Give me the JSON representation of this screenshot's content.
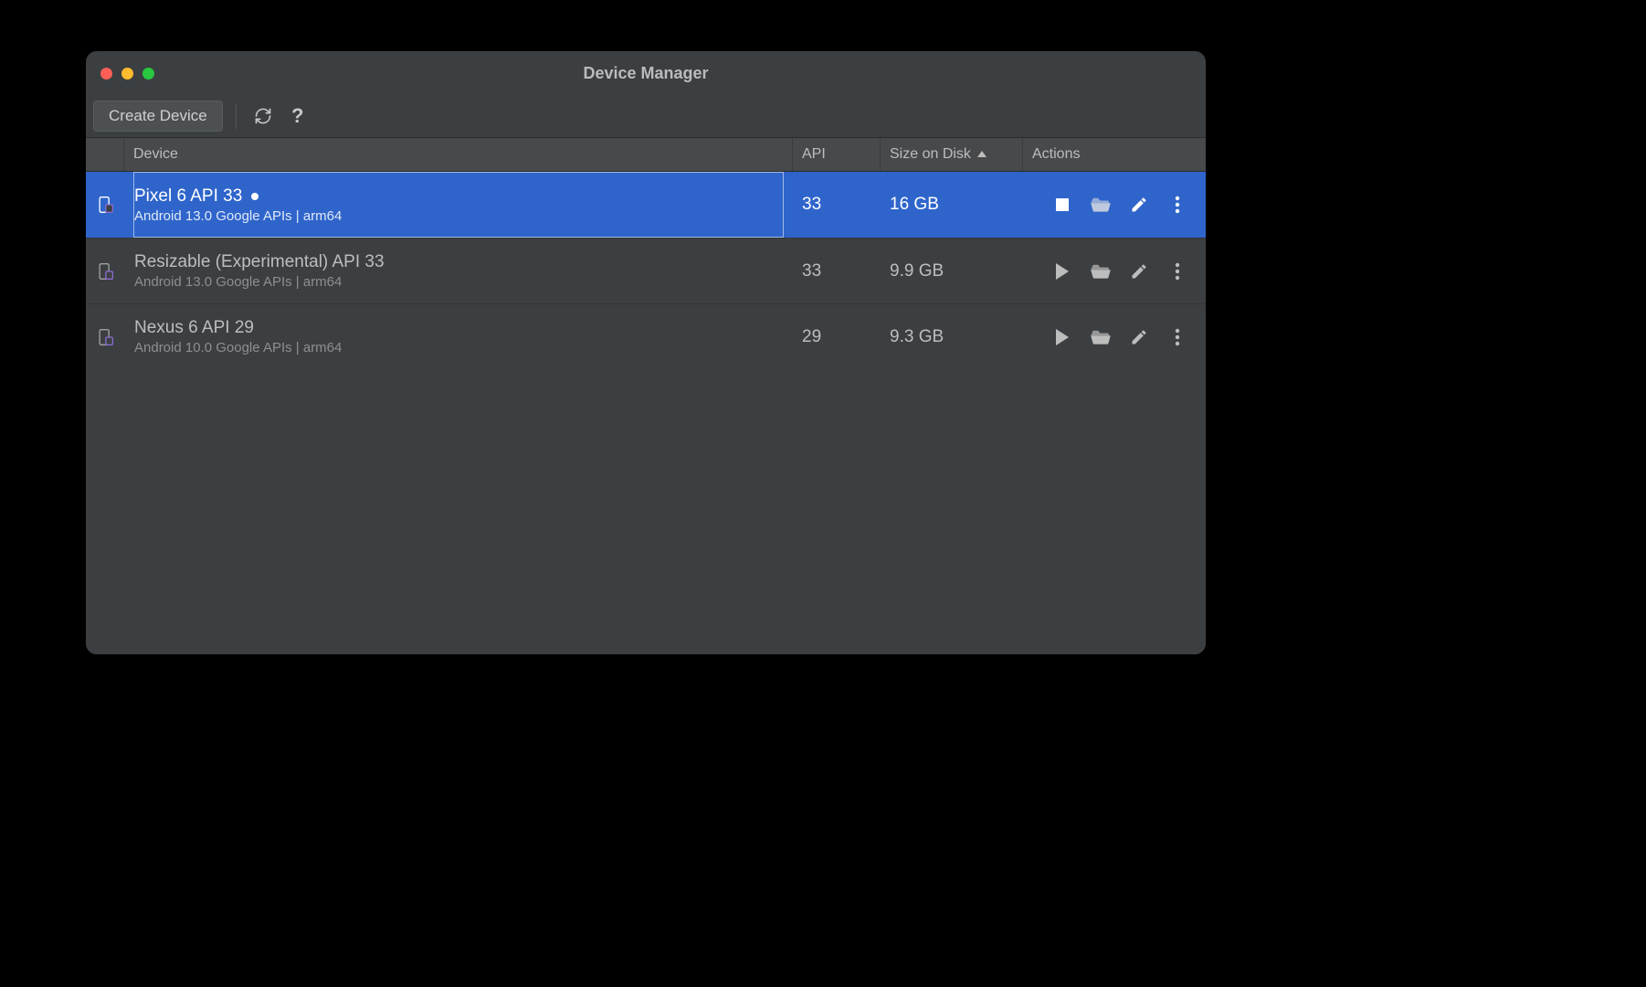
{
  "window": {
    "title": "Device Manager"
  },
  "toolbar": {
    "create_label": "Create Device"
  },
  "columns": {
    "device": "Device",
    "api": "API",
    "size": "Size on Disk",
    "actions": "Actions"
  },
  "sort": {
    "column": "size",
    "direction": "asc"
  },
  "devices": [
    {
      "name": "Pixel 6 API 33",
      "subtitle": "Android 13.0 Google APIs | arm64",
      "api": "33",
      "size": "16 GB",
      "running": true,
      "selected": true
    },
    {
      "name": "Resizable (Experimental) API 33",
      "subtitle": "Android 13.0 Google APIs | arm64",
      "api": "33",
      "size": "9.9 GB",
      "running": false,
      "selected": false
    },
    {
      "name": "Nexus 6 API 29",
      "subtitle": "Android 10.0 Google APIs | arm64",
      "api": "29",
      "size": "9.3 GB",
      "running": false,
      "selected": false
    }
  ]
}
